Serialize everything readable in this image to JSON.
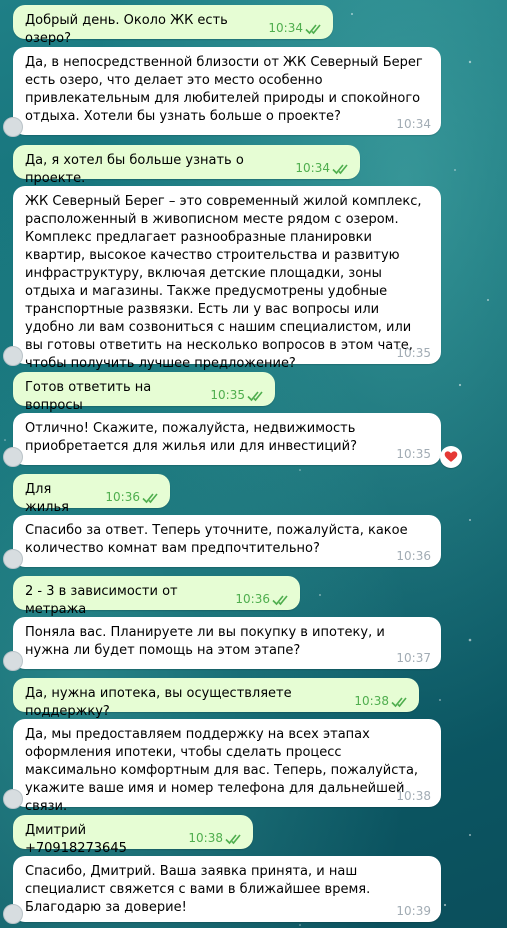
{
  "icons": {
    "read_receipt": "double-check-icon",
    "reaction": "red-heart-icon"
  },
  "colors": {
    "incoming_bubble": "#ffffff",
    "outgoing_bubble": "#e6fdd4",
    "outgoing_time": "#4fae4e",
    "incoming_time": "#a2acb4",
    "reaction_heart": "#e53935"
  },
  "messages": [
    {
      "direction": "out",
      "text": "Добрый день. Около ЖК есть озеро?",
      "time": "10:34",
      "read": true
    },
    {
      "direction": "in",
      "text": "Да, в непосредственной близости от ЖК Северный Берег есть озеро, что делает это место особенно привлекательным для любителей природы и спокойного отдыха. Хотели бы узнать больше о проекте?",
      "time": "10:34"
    },
    {
      "direction": "out",
      "text": "Да, я хотел бы больше узнать о проекте.",
      "time": "10:34",
      "read": true
    },
    {
      "direction": "in",
      "text": "ЖК Северный Берег – это современный жилой комплекс, расположенный в живописном месте рядом с озером. Комплекс предлагает разнообразные планировки квартир, высокое качество строительства и развитую инфраструктуру, включая детские площадки, зоны отдыха и магазины. Также предусмотрены удобные транспортные развязки. Есть ли у вас вопросы или удобно ли вам созвониться с нашим специалистом, или вы готовы ответить на несколько вопросов в этом чате, чтобы получить лучшее предложение?",
      "time": "10:35"
    },
    {
      "direction": "out",
      "text": "Готов ответить на вопросы",
      "time": "10:35",
      "read": true
    },
    {
      "direction": "in",
      "text": "Отлично! Скажите, пожалуйста, недвижимость приобретается для жилья или для инвестиций?",
      "time": "10:35",
      "reaction": "heart"
    },
    {
      "direction": "out",
      "text": "Для жилья",
      "time": "10:36",
      "read": true
    },
    {
      "direction": "in",
      "text": "Спасибо за ответ. Теперь уточните, пожалуйста, какое количество комнат вам предпочтительно?",
      "time": "10:36"
    },
    {
      "direction": "out",
      "text": "2 - 3 в зависимости от метража",
      "time": "10:36",
      "read": true
    },
    {
      "direction": "in",
      "text": "Поняла вас. Планируете ли вы покупку в ипотеку, и нужна ли будет помощь на этом этапе?",
      "time": "10:37"
    },
    {
      "direction": "out",
      "text": "Да, нужна ипотека, вы осуществляете поддержку?",
      "time": "10:38",
      "read": true
    },
    {
      "direction": "in",
      "text": "Да, мы предоставляем поддержку на всех этапах оформления ипотеки, чтобы сделать процесс максимально комфортным для вас. Теперь, пожалуйста, укажите ваше имя и номер телефона для дальнейшей связи.",
      "time": "10:38"
    },
    {
      "direction": "out",
      "text": "Дмитрий +70918273645",
      "time": "10:38",
      "read": true
    },
    {
      "direction": "in",
      "text": "Спасибо, Дмитрий. Ваша заявка принята, и наш специалист свяжется с вами в ближайшее время. Благодарю за доверие!",
      "time": "10:39"
    }
  ]
}
